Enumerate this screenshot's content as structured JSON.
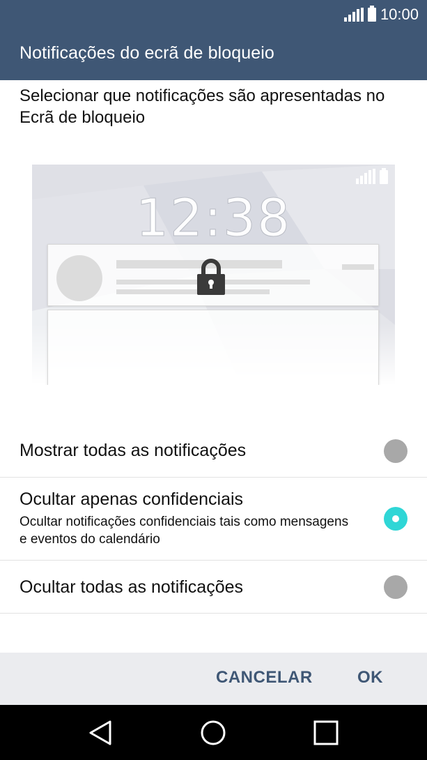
{
  "status_bar": {
    "time": "10:00",
    "signal_icon": "signal-icon",
    "battery_icon": "battery-icon"
  },
  "header": {
    "title": "Notificações do ecrã de bloqueio"
  },
  "description": "Selecionar que notificações são apresentadas no Ecrã de bloqueio",
  "preview": {
    "clock": "12:38",
    "lock_icon": "lock-icon"
  },
  "options": [
    {
      "label": "Mostrar todas as notificações",
      "sublabel": "",
      "selected": false
    },
    {
      "label": "Ocultar apenas confidenciais",
      "sublabel": "Ocultar notificações confidenciais tais como mensagens e eventos do calendário",
      "selected": true
    },
    {
      "label": "Ocultar todas as notificações",
      "sublabel": "",
      "selected": false
    }
  ],
  "actions": {
    "cancel_label": "CANCELAR",
    "ok_label": "OK"
  },
  "nav": {
    "back_icon": "back-icon",
    "home_icon": "home-icon",
    "recents_icon": "recents-icon"
  },
  "colors": {
    "header_bg": "#3f5775",
    "accent": "#2fd6d6",
    "radio_off": "#a8a8a8",
    "button_text": "#3f5775"
  }
}
